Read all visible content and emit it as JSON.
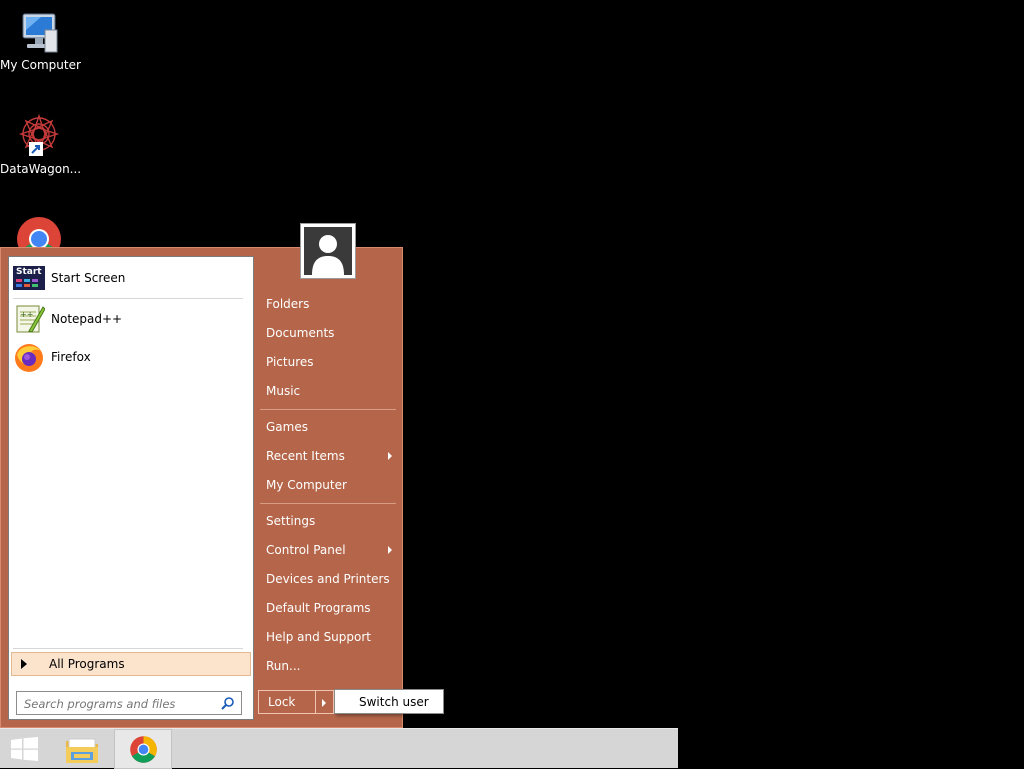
{
  "desktop": {
    "icons": [
      {
        "label": "My Computer",
        "icon": "my-computer-icon"
      },
      {
        "label": "DataWagon...",
        "icon": "datawagon-icon"
      },
      {
        "label": "",
        "icon": "chrome-icon"
      }
    ]
  },
  "start_menu": {
    "pinned": [
      {
        "label": "Start Screen",
        "icon": "start-screen-icon",
        "icon_text": "Start"
      },
      {
        "label": "Notepad++",
        "icon": "notepadpp-icon"
      },
      {
        "label": "Firefox",
        "icon": "firefox-icon"
      }
    ],
    "all_programs": "All Programs",
    "search": {
      "placeholder": "Search programs and files",
      "value": ""
    },
    "right_items": [
      {
        "label": "Folders"
      },
      {
        "label": "Documents"
      },
      {
        "label": "Pictures"
      },
      {
        "label": "Music"
      },
      {
        "label": "Games"
      },
      {
        "label": "Recent Items",
        "submenu": true
      },
      {
        "label": "My Computer"
      },
      {
        "label": "Settings"
      },
      {
        "label": "Control Panel",
        "submenu": true
      },
      {
        "label": "Devices and Printers"
      },
      {
        "label": "Default Programs"
      },
      {
        "label": "Help and Support"
      },
      {
        "label": "Run..."
      }
    ],
    "lock_label": "Lock",
    "switch_user_label": "Switch user"
  },
  "taskbar": {
    "items": [
      {
        "icon": "windows-start-icon"
      },
      {
        "icon": "file-explorer-icon"
      },
      {
        "icon": "chrome-icon",
        "active": true
      }
    ]
  },
  "colors": {
    "menu_accent": "#b5664a",
    "desktop_bg": "#000000",
    "taskbar_bg": "#d6d6d6"
  }
}
